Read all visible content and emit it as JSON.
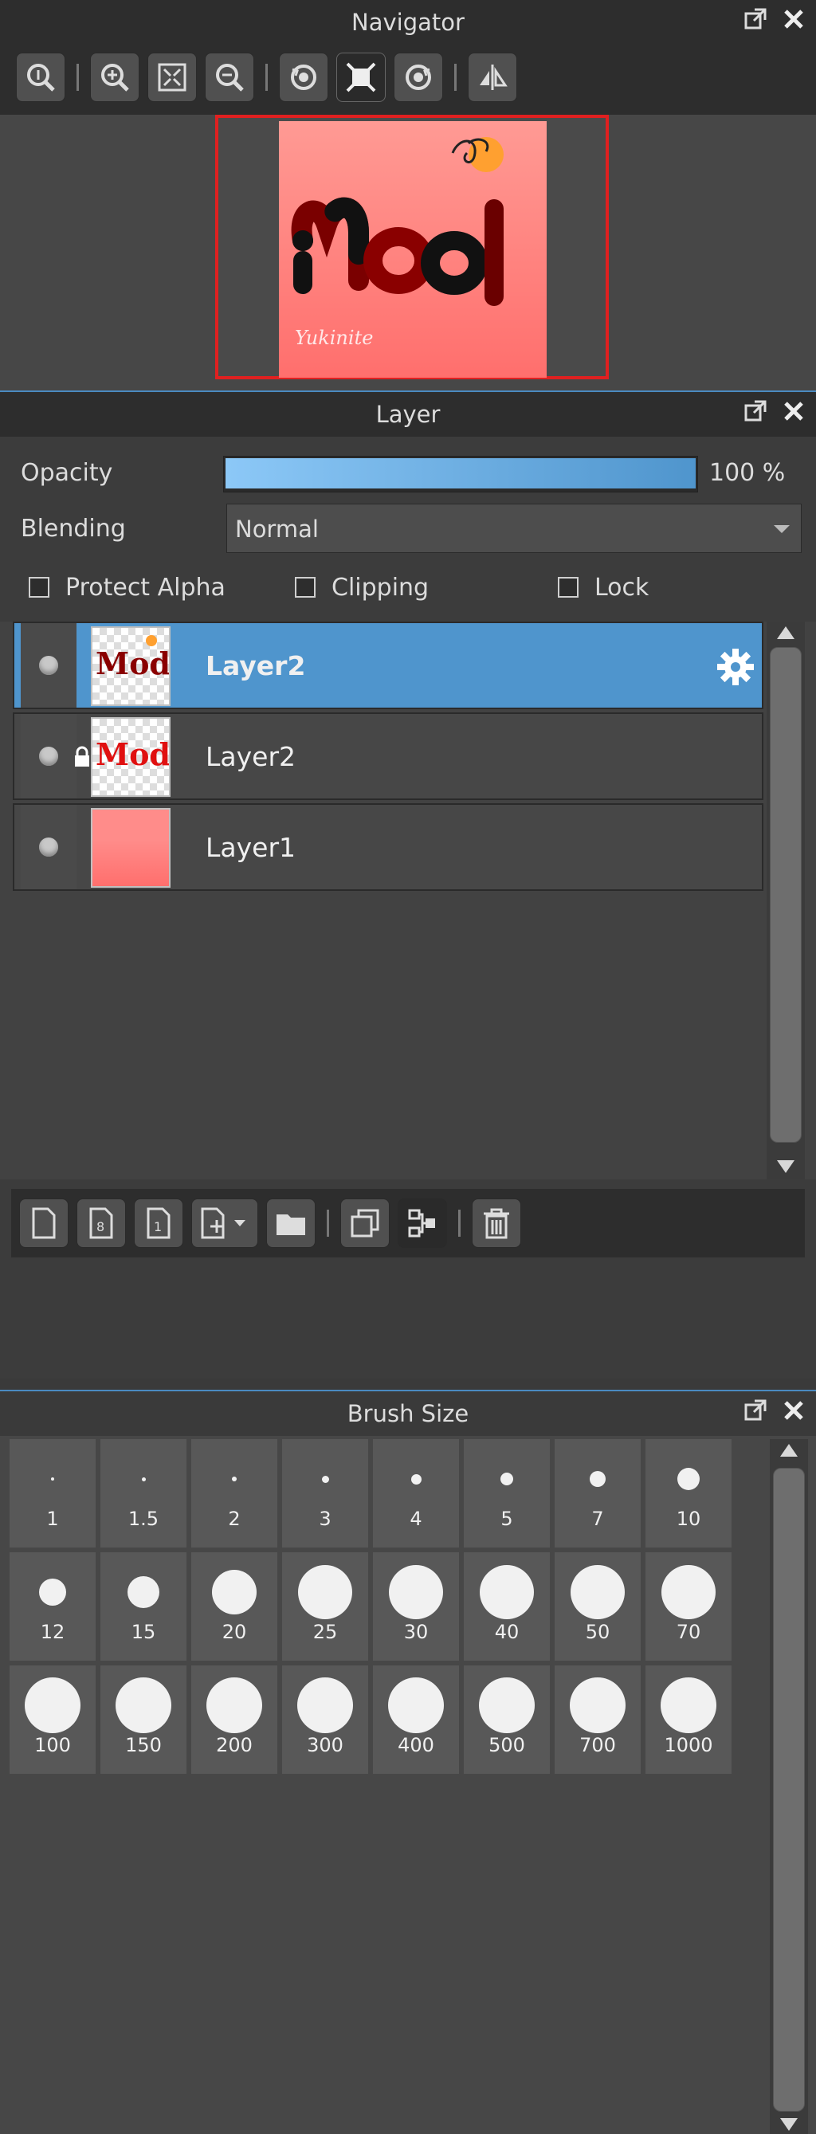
{
  "navigator": {
    "title": "Navigator",
    "tools": [
      "zoom-actual-icon",
      "zoom-in-icon",
      "fit-icon",
      "zoom-out-icon",
      "rotate-left-icon",
      "reset-view-icon",
      "rotate-right-icon",
      "flip-icon"
    ],
    "preview": {
      "text": "Mod",
      "signature": "Yukinite"
    }
  },
  "layer_panel": {
    "title": "Layer",
    "opacity_label": "Opacity",
    "opacity_value": "100 %",
    "opacity_level": 1.0,
    "blending_label": "Blending",
    "blending_value": "Normal",
    "protect_alpha_label": "Protect Alpha",
    "clipping_label": "Clipping",
    "lock_label": "Lock",
    "layers": [
      {
        "name": "Layer2",
        "selected": true,
        "locked": false
      },
      {
        "name": "Layer2",
        "selected": false,
        "locked": true
      },
      {
        "name": "Layer1",
        "selected": false,
        "locked": false
      }
    ]
  },
  "brush_panel": {
    "title": "Brush Size",
    "sizes": [
      "1",
      "1.5",
      "2",
      "3",
      "4",
      "5",
      "7",
      "10",
      "12",
      "15",
      "20",
      "25",
      "30",
      "40",
      "50",
      "70",
      "100",
      "150",
      "200",
      "300",
      "400",
      "500",
      "700",
      "1000"
    ]
  },
  "colors": {
    "accent": "#4f95cd",
    "preview_bg": "#ff8f8b",
    "preview_border": "#e02020"
  }
}
